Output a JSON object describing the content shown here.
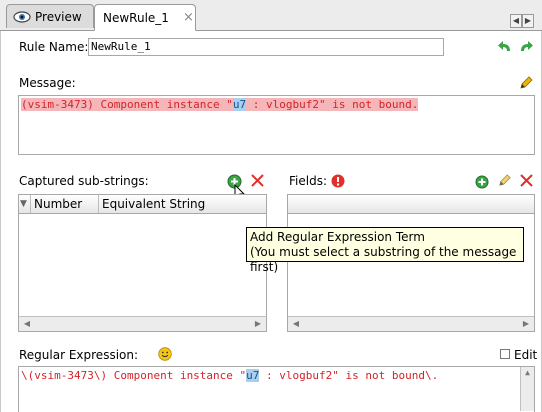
{
  "tabs": [
    {
      "label": "Preview",
      "icon": "eye-icon",
      "active": false
    },
    {
      "label": "NewRule_1",
      "active": true,
      "close": "×"
    }
  ],
  "rule": {
    "label": "Rule Name:",
    "value": "NewRule_1"
  },
  "message": {
    "label": "Message:",
    "text_before": "(vsim-3473) Component instance \"",
    "text_selected": "u7",
    "text_after": " : vlogbuf2\" is not bound."
  },
  "captured": {
    "label": "Captured sub-strings:",
    "columns": [
      "Number",
      "Equivalent String"
    ]
  },
  "fields": {
    "label": "Fields:"
  },
  "tooltip": {
    "line1": "Add Regular Expression Term",
    "line2": "(You must select a substring of the message first)"
  },
  "regex": {
    "label": "Regular Expression:",
    "edit_label": "Edit",
    "text_before": "\\(vsim-3473\\) Component instance \"",
    "text_selected": "u7",
    "text_after": " : vlogbuf2\" is not bound\\."
  },
  "colors": {
    "accent_green": "#3aa545",
    "error_red": "#e0302b",
    "message_highlight": "#f4b6b8",
    "selection": "#a9cfee"
  }
}
